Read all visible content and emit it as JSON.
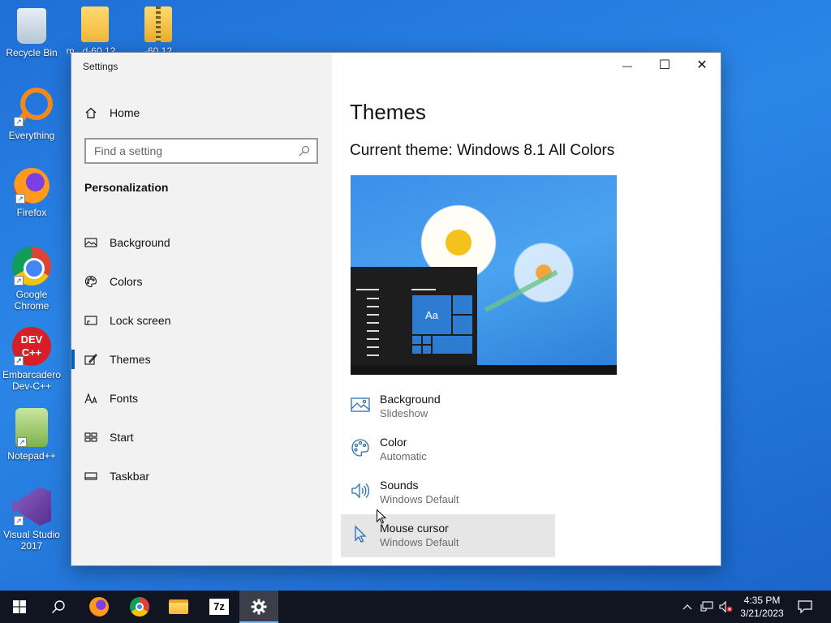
{
  "desktop": {
    "icons": [
      {
        "label": "Recycle Bin"
      },
      {
        "label": "m...d-60.12..."
      },
      {
        "label": "...-60.12..."
      },
      {
        "label": "Everything"
      },
      {
        "label": "Firefox"
      },
      {
        "label": "Google Chrome"
      },
      {
        "label": "Embarcadero Dev-C++"
      },
      {
        "label": "Notepad++"
      },
      {
        "label": "Visual Studio 2017"
      }
    ],
    "dev_glyph_text": "DEV C++"
  },
  "window": {
    "title": "Settings",
    "controls": {
      "minimize": "—",
      "maximize": "☐",
      "close": "✕"
    }
  },
  "sidebar": {
    "home_label": "Home",
    "search_placeholder": "Find a setting",
    "section": "Personalization",
    "items": [
      {
        "label": "Background"
      },
      {
        "label": "Colors"
      },
      {
        "label": "Lock screen"
      },
      {
        "label": "Themes",
        "selected": true
      },
      {
        "label": "Fonts"
      },
      {
        "label": "Start"
      },
      {
        "label": "Taskbar"
      }
    ]
  },
  "main": {
    "title": "Themes",
    "current_theme": "Current theme: Windows 8.1 All Colors",
    "preview_tile_text": "Aa",
    "options": [
      {
        "name": "Background",
        "value": "Slideshow"
      },
      {
        "name": "Color",
        "value": "Automatic"
      },
      {
        "name": "Sounds",
        "value": "Windows Default"
      },
      {
        "name": "Mouse cursor",
        "value": "Windows Default"
      }
    ]
  },
  "taskbar": {
    "apps": [
      "start",
      "search",
      "firefox",
      "chrome",
      "file-explorer",
      "7zip",
      "settings"
    ],
    "seven_zip_text": "7z",
    "clock_time": "4:35 PM",
    "clock_date": "3/21/2023"
  },
  "colors": {
    "accent": "#0063b1",
    "icon_blue": "#2b6fb6"
  }
}
